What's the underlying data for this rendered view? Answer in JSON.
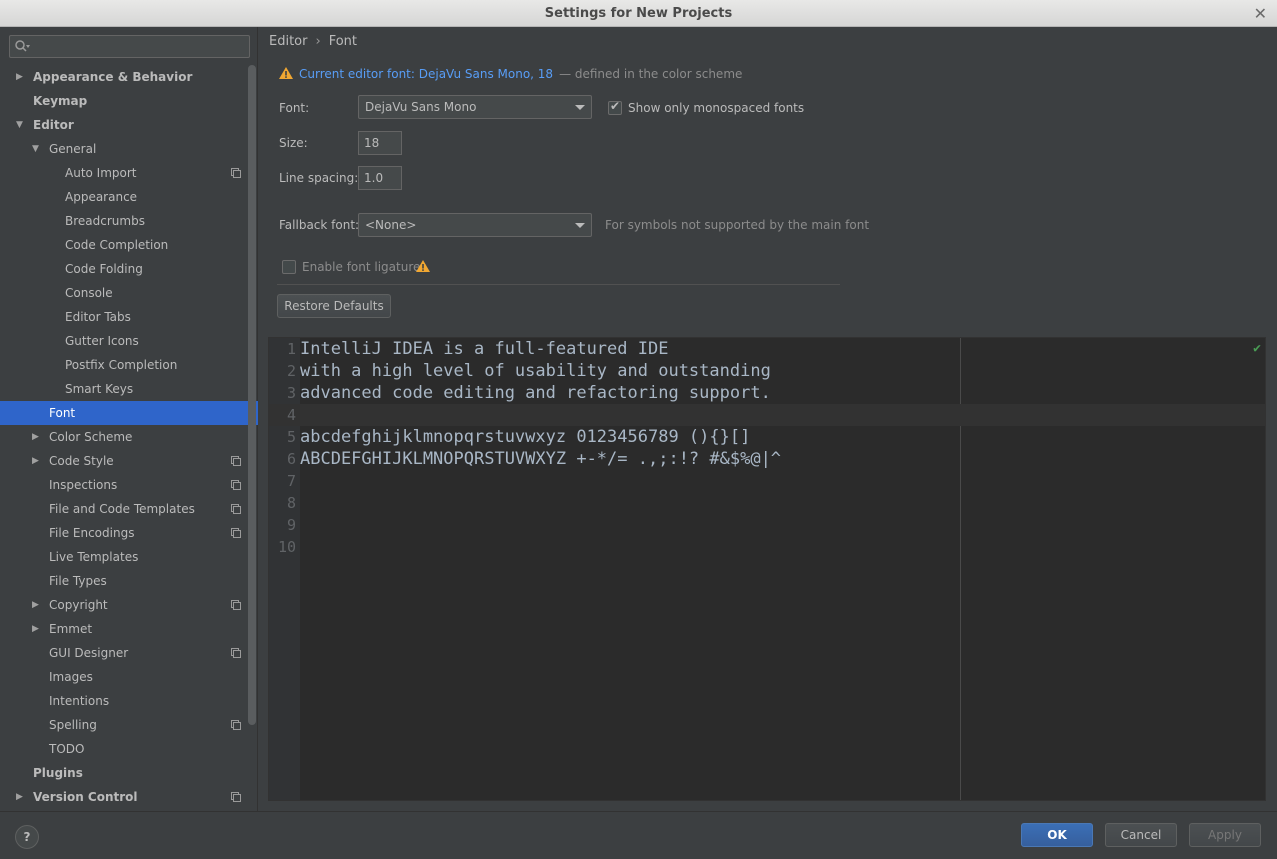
{
  "window": {
    "title": "Settings for New Projects",
    "close_glyph": "✕"
  },
  "search": {
    "placeholder": "",
    "icon": "search-icon"
  },
  "tree": [
    {
      "label": "Appearance & Behavior",
      "level": 0,
      "arrow": "right",
      "bold": true,
      "proj": false
    },
    {
      "label": "Keymap",
      "level": 0,
      "arrow": "",
      "bold": true,
      "proj": false
    },
    {
      "label": "Editor",
      "level": 0,
      "arrow": "down",
      "bold": true,
      "proj": false
    },
    {
      "label": "General",
      "level": 1,
      "arrow": "down",
      "bold": false,
      "proj": false
    },
    {
      "label": "Auto Import",
      "level": 2,
      "arrow": "",
      "bold": false,
      "proj": true
    },
    {
      "label": "Appearance",
      "level": 2,
      "arrow": "",
      "bold": false,
      "proj": false
    },
    {
      "label": "Breadcrumbs",
      "level": 2,
      "arrow": "",
      "bold": false,
      "proj": false
    },
    {
      "label": "Code Completion",
      "level": 2,
      "arrow": "",
      "bold": false,
      "proj": false
    },
    {
      "label": "Code Folding",
      "level": 2,
      "arrow": "",
      "bold": false,
      "proj": false
    },
    {
      "label": "Console",
      "level": 2,
      "arrow": "",
      "bold": false,
      "proj": false
    },
    {
      "label": "Editor Tabs",
      "level": 2,
      "arrow": "",
      "bold": false,
      "proj": false
    },
    {
      "label": "Gutter Icons",
      "level": 2,
      "arrow": "",
      "bold": false,
      "proj": false
    },
    {
      "label": "Postfix Completion",
      "level": 2,
      "arrow": "",
      "bold": false,
      "proj": false
    },
    {
      "label": "Smart Keys",
      "level": 2,
      "arrow": "",
      "bold": false,
      "proj": false
    },
    {
      "label": "Font",
      "level": 1,
      "arrow": "",
      "bold": false,
      "proj": false,
      "selected": true
    },
    {
      "label": "Color Scheme",
      "level": 1,
      "arrow": "right",
      "bold": false,
      "proj": false
    },
    {
      "label": "Code Style",
      "level": 1,
      "arrow": "right",
      "bold": false,
      "proj": true
    },
    {
      "label": "Inspections",
      "level": 1,
      "arrow": "",
      "bold": false,
      "proj": true
    },
    {
      "label": "File and Code Templates",
      "level": 1,
      "arrow": "",
      "bold": false,
      "proj": true
    },
    {
      "label": "File Encodings",
      "level": 1,
      "arrow": "",
      "bold": false,
      "proj": true
    },
    {
      "label": "Live Templates",
      "level": 1,
      "arrow": "",
      "bold": false,
      "proj": false
    },
    {
      "label": "File Types",
      "level": 1,
      "arrow": "",
      "bold": false,
      "proj": false
    },
    {
      "label": "Copyright",
      "level": 1,
      "arrow": "right",
      "bold": false,
      "proj": true
    },
    {
      "label": "Emmet",
      "level": 1,
      "arrow": "right",
      "bold": false,
      "proj": false
    },
    {
      "label": "GUI Designer",
      "level": 1,
      "arrow": "",
      "bold": false,
      "proj": true
    },
    {
      "label": "Images",
      "level": 1,
      "arrow": "",
      "bold": false,
      "proj": false
    },
    {
      "label": "Intentions",
      "level": 1,
      "arrow": "",
      "bold": false,
      "proj": false
    },
    {
      "label": "Spelling",
      "level": 1,
      "arrow": "",
      "bold": false,
      "proj": true
    },
    {
      "label": "TODO",
      "level": 1,
      "arrow": "",
      "bold": false,
      "proj": false
    },
    {
      "label": "Plugins",
      "level": 0,
      "arrow": "",
      "bold": true,
      "proj": false
    },
    {
      "label": "Version Control",
      "level": 0,
      "arrow": "right",
      "bold": true,
      "proj": true
    }
  ],
  "breadcrumb": {
    "parent": "Editor",
    "separator": "›",
    "current": "Font"
  },
  "warning": {
    "link": "Current editor font: DejaVu Sans Mono, 18",
    "note": "— defined in the color scheme"
  },
  "font": {
    "label": "Font:",
    "value": "DejaVu Sans Mono",
    "mono_only_label": "Show only monospaced fonts",
    "mono_only_checked": true
  },
  "size": {
    "label": "Size:",
    "value": "18"
  },
  "line_spacing": {
    "label": "Line spacing:",
    "value": "1.0"
  },
  "fallback": {
    "label": "Fallback font:",
    "value": "<None>",
    "hint": "For symbols not supported by the main font"
  },
  "ligatures": {
    "label": "Enable font ligatures",
    "checked": false
  },
  "restore_label": "Restore Defaults",
  "preview": {
    "lines": [
      {
        "num": "1",
        "text": "IntelliJ IDEA is a full-featured IDE"
      },
      {
        "num": "2",
        "text": "with a high level of usability and outstanding"
      },
      {
        "num": "3",
        "text": "advanced code editing and refactoring support."
      },
      {
        "num": "4",
        "text": ""
      },
      {
        "num": "5",
        "text": "abcdefghijklmnopqrstuvwxyz 0123456789 (){}[]"
      },
      {
        "num": "6",
        "text": "ABCDEFGHIJKLMNOPQRSTUVWXYZ +-*/= .,;:!? #&$%@|^"
      },
      {
        "num": "7",
        "text": ""
      },
      {
        "num": "8",
        "text": ""
      },
      {
        "num": "9",
        "text": ""
      },
      {
        "num": "10",
        "text": ""
      }
    ],
    "current_line": 3,
    "inspection_icon": "check-icon"
  },
  "footer": {
    "help": "?",
    "ok": "OK",
    "cancel": "Cancel",
    "apply": "Apply"
  }
}
